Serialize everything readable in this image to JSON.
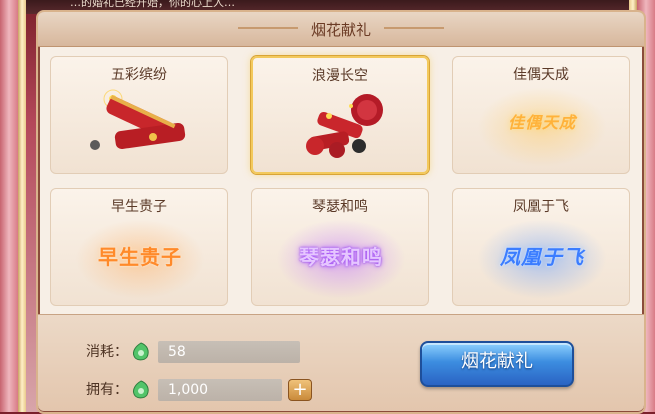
{
  "banner": {
    "text": "…的婚礼已经开始，你的心上人…"
  },
  "dialog": {
    "title": "烟花献礼"
  },
  "fireworks": [
    {
      "label": "五彩缤纷",
      "art": "firecracker-red",
      "art_text": ""
    },
    {
      "label": "浪漫长空",
      "art": "firecracker-cluster",
      "art_text": "",
      "selected": true
    },
    {
      "label": "佳偶天成",
      "art": "calligraphy-gold",
      "art_text": "佳偶天成"
    },
    {
      "label": "早生贵子",
      "art": "calligraphy-orange",
      "art_text": "早生贵子"
    },
    {
      "label": "琴瑟和鸣",
      "art": "calligraphy-purple",
      "art_text": "琴瑟和鸣"
    },
    {
      "label": "凤凰于飞",
      "art": "calligraphy-blue",
      "art_text": "凤凰于飞"
    }
  ],
  "cost": {
    "label": "消耗：",
    "value": "58",
    "icon": "green-jade-icon"
  },
  "owned": {
    "label": "拥有：",
    "value": "1,000",
    "icon": "green-jade-icon",
    "add_label": "+"
  },
  "action": {
    "label": "烟花献礼"
  },
  "colors": {
    "accent_gold": "#f3c95c",
    "button_blue": "#3c8de0",
    "panel_bg": "#f7efe6"
  }
}
